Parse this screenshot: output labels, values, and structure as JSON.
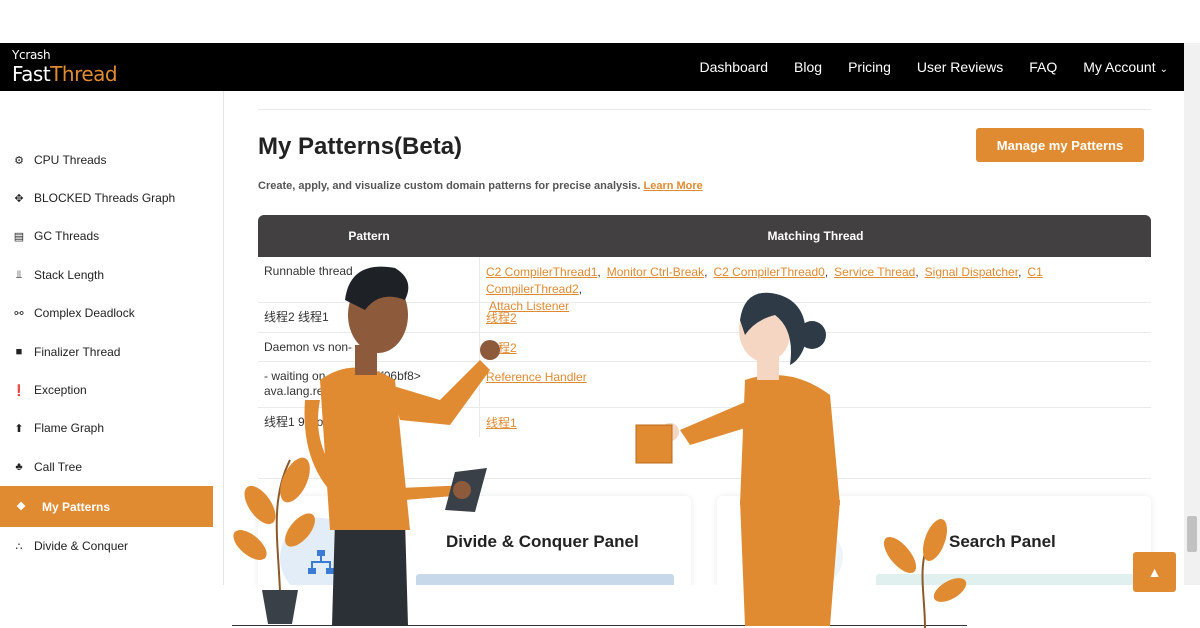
{
  "navbar": {
    "logo_small": "Ycrash",
    "logo_fast": "Fast",
    "logo_thread": "Thread",
    "links": [
      "Dashboard",
      "Blog",
      "Pricing",
      "User Reviews",
      "FAQ",
      "My Account"
    ],
    "account_caret": "⌄"
  },
  "sidebar": {
    "items": [
      {
        "label": "CPU Threads",
        "icon": "gears-icon",
        "glyph": "⚙"
      },
      {
        "label": "BLOCKED Threads Graph",
        "icon": "arrows-icon",
        "glyph": "✥"
      },
      {
        "label": "GC Threads",
        "icon": "trash-icon",
        "glyph": "▤"
      },
      {
        "label": "Stack Length",
        "icon": "stairs-icon",
        "glyph": "⫫"
      },
      {
        "label": "Complex Deadlock",
        "icon": "link-icon",
        "glyph": "⚯"
      },
      {
        "label": "Finalizer Thread",
        "icon": "square-icon",
        "glyph": "■"
      },
      {
        "label": "Exception",
        "icon": "exclamation-icon",
        "glyph": "❗"
      },
      {
        "label": "Flame Graph",
        "icon": "fire-icon",
        "glyph": "⬆"
      },
      {
        "label": "Call Tree",
        "icon": "tree-icon",
        "glyph": "♣"
      },
      {
        "label": "My Patterns",
        "icon": "puzzle-icon",
        "glyph": "❖"
      },
      {
        "label": "Divide & Conquer",
        "icon": "hierarchy-icon",
        "glyph": "∴"
      }
    ],
    "active_index": 9
  },
  "main": {
    "title": "My Patterns(Beta)",
    "manage_button": "Manage my Patterns",
    "subtitle": "Create, apply, and visualize custom domain patterns for precise analysis.",
    "learn_more": "Learn More",
    "table": {
      "headers": [
        "Pattern",
        "Matching Thread"
      ],
      "rows": [
        {
          "pattern": "Runnable thread",
          "threads": [
            "C2 CompilerThread1",
            "Monitor Ctrl-Break",
            "C2 CompilerThread0",
            "Service Thread",
            "Signal Dispatcher",
            "C1 CompilerThread2",
            "Attach Listener"
          ]
        },
        {
          "pattern": "线程2 线程1",
          "threads": [
            "线程2"
          ]
        },
        {
          "pattern": "Daemon vs non-",
          "threads": [
            "线程2"
          ]
        },
        {
          "pattern": "- waiting on <0",
          "pattern2": "0d5f06bf8>",
          "pattern3": "ava.lang.ref.",
          "pattern4": "k)",
          "threads": [
            "Reference Handler"
          ]
        },
        {
          "pattern": "线程1 9 Nor",
          "threads": [
            "线程1"
          ]
        }
      ]
    },
    "panels": {
      "left_title": "Divide & Conquer Panel",
      "right_title": "Search Panel"
    }
  },
  "colors": {
    "accent": "#e08b32",
    "navbar": "#000000",
    "table_header": "#424041"
  }
}
